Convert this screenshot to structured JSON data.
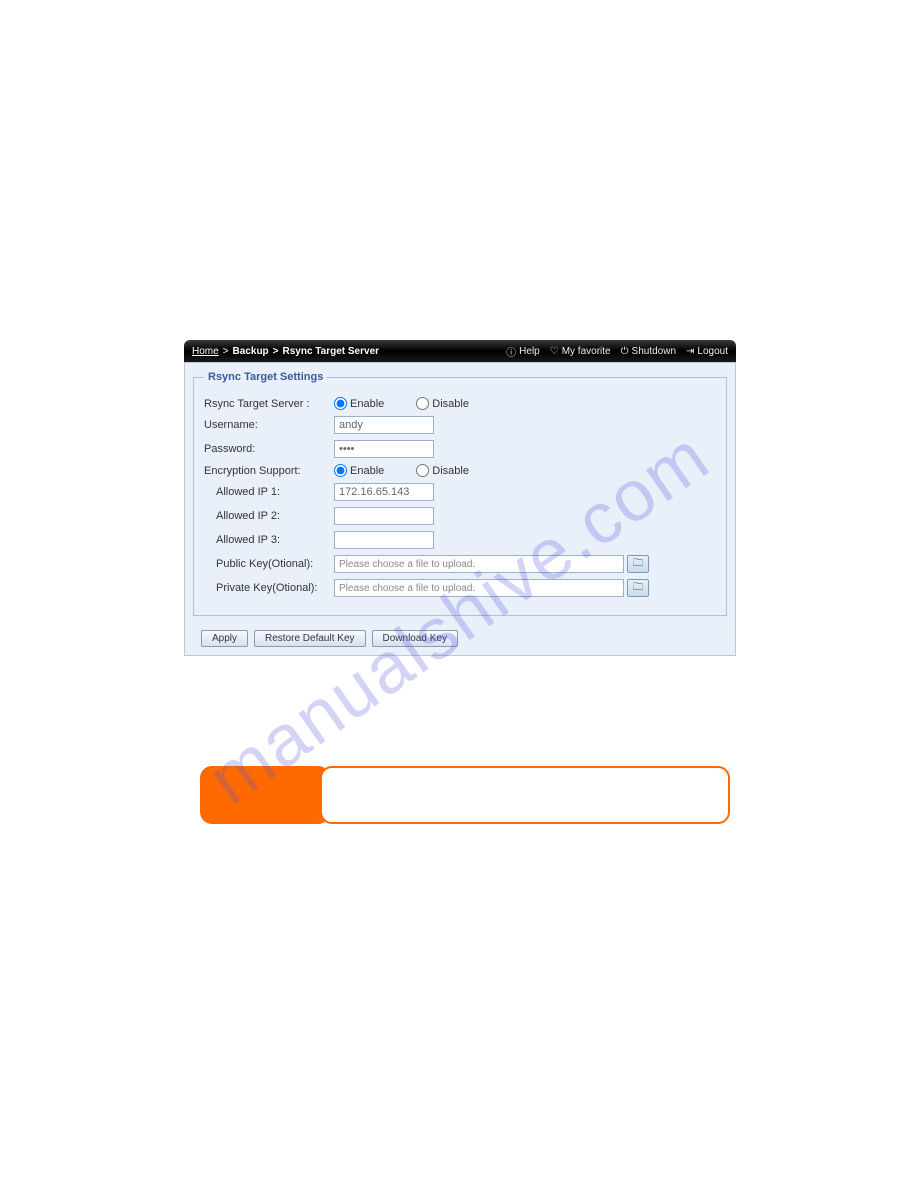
{
  "breadcrumb": {
    "home": "Home",
    "sep1": ">",
    "backup": "Backup",
    "sep2": ">",
    "current": "Rsync Target Server"
  },
  "topbar": {
    "help": "Help",
    "favorite": "My favorite",
    "shutdown": "Shutdown",
    "logout": "Logout"
  },
  "fieldset": {
    "legend": "Rsync Target Settings"
  },
  "labels": {
    "target": "Rsync Target Server :",
    "username": "Username:",
    "password": "Password:",
    "encryption": "Encryption Support:",
    "ip1": "Allowed IP 1:",
    "ip2": "Allowed IP 2:",
    "ip3": "Allowed IP 3:",
    "pubkey": "Public Key(Otional):",
    "privkey": "Private Key(Otional):"
  },
  "radios": {
    "enable": "Enable",
    "disable": "Disable"
  },
  "values": {
    "username": "andy",
    "password": "••••",
    "ip1": "172.16.65.143",
    "ip2": "",
    "ip3": "",
    "filePlaceholder": "Please choose a file to upload."
  },
  "buttons": {
    "apply": "Apply",
    "restore": "Restore Default Key",
    "download": "Download Key"
  },
  "watermark": "manualshive.com"
}
